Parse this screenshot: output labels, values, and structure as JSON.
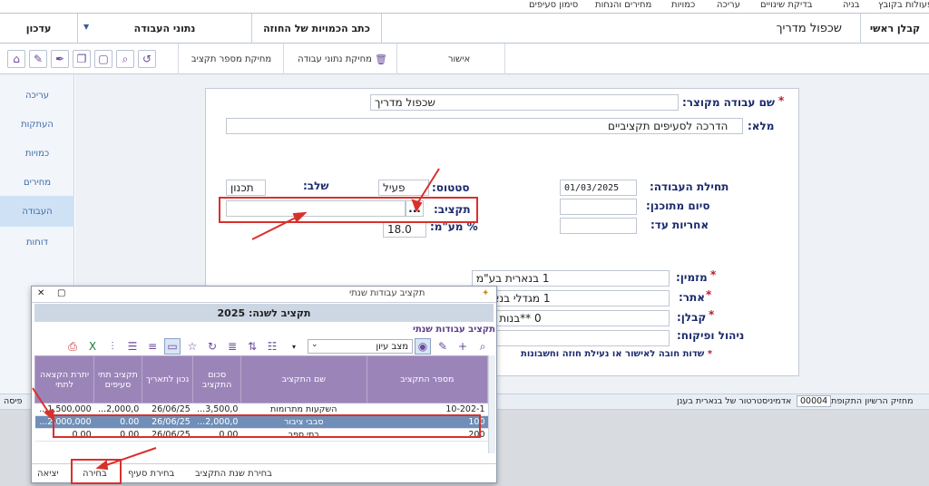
{
  "menubar": [
    "פעולות בקובץ",
    "בניה",
    "בדיקת שינויים",
    "עריכה",
    "כמויות",
    "מחירים והנחות",
    "סימון סעיפים"
  ],
  "header": {
    "user": "קבלן ראשי",
    "title": "שכפול מדריך",
    "contract_qty": "כתב הכמויות של החוזה",
    "work_data": "נתוני העבודה",
    "update": "עדכון"
  },
  "toolbar": {
    "approve": "אישור",
    "delete_work_data": "מחיקת נתוני עבודה",
    "delete_budget_number": "מחיקת מספר תקציב"
  },
  "sidebar": [
    "עריכה",
    "העתקות",
    "כמויות",
    "מחירים",
    "העבודה",
    "דוחות"
  ],
  "form": {
    "short_name_label": "שם עבודה מקוצר:",
    "short_name": "שכפול מדריך",
    "full_label": "מלא:",
    "full_name": "הדרכה לסעיפים תקציביים",
    "start_label": "תחילת העבודה:",
    "start_date": "01/03/2025",
    "planned_end_label": "סיום מתוכנן:",
    "warranty_label": "אחריות עד:",
    "status_label": "סטטוס:",
    "status": "פעיל",
    "stage_label": "שלב:",
    "stage": "תכנון",
    "budget_label": "תקציב:",
    "budget_btn": "...",
    "vat_label": "% מע\"מ:",
    "vat": "18.0",
    "orderer_label": "מזמין:",
    "orderer": "1  בנארית בע\"מ",
    "site_label": "אתר:",
    "site": "1  מגדלי בנארית",
    "contractor_label": "קבלן:",
    "contractor": "0  **בנות יוסף",
    "supervision_label": "ניהול ופיקוח:",
    "required_note": "שדות חובה לאישור או נעילת חוזה וחשבונות"
  },
  "statusbar": {
    "license": "מחזיק הרשיון התקופתי",
    "license_no": "00004",
    "admin": "אדמיניסטרטור של בנארית בענן",
    "left": "פיסה"
  },
  "dialog": {
    "title": "תקציב עבודות שנתי",
    "year_title": "תקציב לשנה: 2025",
    "subtitle": "תקציב עבודות שנתי",
    "view_mode": "מצב עיון",
    "columns": [
      "מספר התקציב",
      "שם התקציב",
      "סכום התקציב",
      "נכון לתאריך",
      "תקציב תתי סעיפים",
      "יתרת הקצאה לתתי"
    ],
    "rows": [
      [
        "10-202-1",
        "השקעות מתרומות",
        "3,500,0...",
        "26/06/25",
        "2,000,0...",
        "1,500,000..."
      ],
      [
        "100",
        "סבבי ציבור",
        "2,000,0...",
        "26/06/25",
        "0.00",
        "2,000,000..."
      ],
      [
        "200",
        "בתי ספר",
        "0.00",
        "26/06/25",
        "0.00",
        "0.00"
      ]
    ],
    "footer": {
      "select_year": "בחירת שנת התקציב",
      "select_item": "בחירת סעיף",
      "select": "בחירה",
      "exit": "יציאה"
    }
  }
}
